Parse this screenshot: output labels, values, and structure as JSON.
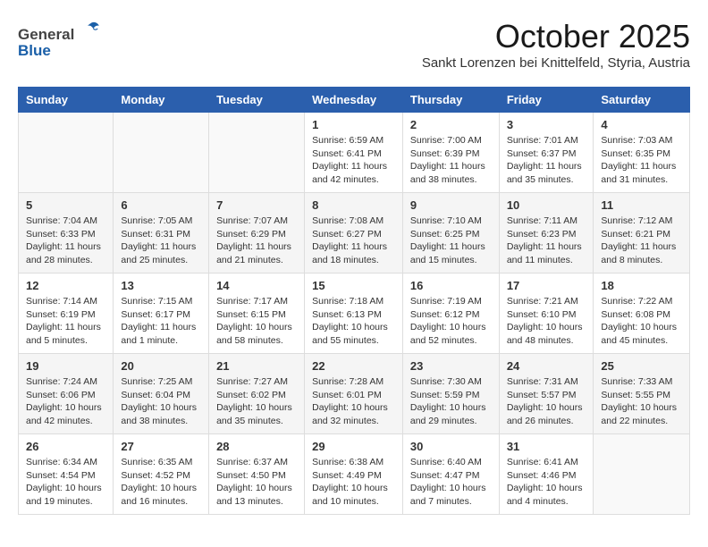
{
  "logo": {
    "general": "General",
    "blue": "Blue"
  },
  "header": {
    "month_title": "October 2025",
    "location": "Sankt Lorenzen bei Knittelfeld, Styria, Austria"
  },
  "weekdays": [
    "Sunday",
    "Monday",
    "Tuesday",
    "Wednesday",
    "Thursday",
    "Friday",
    "Saturday"
  ],
  "weeks": [
    [
      {
        "day": "",
        "sunrise": "",
        "sunset": "",
        "daylight": ""
      },
      {
        "day": "",
        "sunrise": "",
        "sunset": "",
        "daylight": ""
      },
      {
        "day": "",
        "sunrise": "",
        "sunset": "",
        "daylight": ""
      },
      {
        "day": "1",
        "sunrise": "Sunrise: 6:59 AM",
        "sunset": "Sunset: 6:41 PM",
        "daylight": "Daylight: 11 hours and 42 minutes."
      },
      {
        "day": "2",
        "sunrise": "Sunrise: 7:00 AM",
        "sunset": "Sunset: 6:39 PM",
        "daylight": "Daylight: 11 hours and 38 minutes."
      },
      {
        "day": "3",
        "sunrise": "Sunrise: 7:01 AM",
        "sunset": "Sunset: 6:37 PM",
        "daylight": "Daylight: 11 hours and 35 minutes."
      },
      {
        "day": "4",
        "sunrise": "Sunrise: 7:03 AM",
        "sunset": "Sunset: 6:35 PM",
        "daylight": "Daylight: 11 hours and 31 minutes."
      }
    ],
    [
      {
        "day": "5",
        "sunrise": "Sunrise: 7:04 AM",
        "sunset": "Sunset: 6:33 PM",
        "daylight": "Daylight: 11 hours and 28 minutes."
      },
      {
        "day": "6",
        "sunrise": "Sunrise: 7:05 AM",
        "sunset": "Sunset: 6:31 PM",
        "daylight": "Daylight: 11 hours and 25 minutes."
      },
      {
        "day": "7",
        "sunrise": "Sunrise: 7:07 AM",
        "sunset": "Sunset: 6:29 PM",
        "daylight": "Daylight: 11 hours and 21 minutes."
      },
      {
        "day": "8",
        "sunrise": "Sunrise: 7:08 AM",
        "sunset": "Sunset: 6:27 PM",
        "daylight": "Daylight: 11 hours and 18 minutes."
      },
      {
        "day": "9",
        "sunrise": "Sunrise: 7:10 AM",
        "sunset": "Sunset: 6:25 PM",
        "daylight": "Daylight: 11 hours and 15 minutes."
      },
      {
        "day": "10",
        "sunrise": "Sunrise: 7:11 AM",
        "sunset": "Sunset: 6:23 PM",
        "daylight": "Daylight: 11 hours and 11 minutes."
      },
      {
        "day": "11",
        "sunrise": "Sunrise: 7:12 AM",
        "sunset": "Sunset: 6:21 PM",
        "daylight": "Daylight: 11 hours and 8 minutes."
      }
    ],
    [
      {
        "day": "12",
        "sunrise": "Sunrise: 7:14 AM",
        "sunset": "Sunset: 6:19 PM",
        "daylight": "Daylight: 11 hours and 5 minutes."
      },
      {
        "day": "13",
        "sunrise": "Sunrise: 7:15 AM",
        "sunset": "Sunset: 6:17 PM",
        "daylight": "Daylight: 11 hours and 1 minute."
      },
      {
        "day": "14",
        "sunrise": "Sunrise: 7:17 AM",
        "sunset": "Sunset: 6:15 PM",
        "daylight": "Daylight: 10 hours and 58 minutes."
      },
      {
        "day": "15",
        "sunrise": "Sunrise: 7:18 AM",
        "sunset": "Sunset: 6:13 PM",
        "daylight": "Daylight: 10 hours and 55 minutes."
      },
      {
        "day": "16",
        "sunrise": "Sunrise: 7:19 AM",
        "sunset": "Sunset: 6:12 PM",
        "daylight": "Daylight: 10 hours and 52 minutes."
      },
      {
        "day": "17",
        "sunrise": "Sunrise: 7:21 AM",
        "sunset": "Sunset: 6:10 PM",
        "daylight": "Daylight: 10 hours and 48 minutes."
      },
      {
        "day": "18",
        "sunrise": "Sunrise: 7:22 AM",
        "sunset": "Sunset: 6:08 PM",
        "daylight": "Daylight: 10 hours and 45 minutes."
      }
    ],
    [
      {
        "day": "19",
        "sunrise": "Sunrise: 7:24 AM",
        "sunset": "Sunset: 6:06 PM",
        "daylight": "Daylight: 10 hours and 42 minutes."
      },
      {
        "day": "20",
        "sunrise": "Sunrise: 7:25 AM",
        "sunset": "Sunset: 6:04 PM",
        "daylight": "Daylight: 10 hours and 38 minutes."
      },
      {
        "day": "21",
        "sunrise": "Sunrise: 7:27 AM",
        "sunset": "Sunset: 6:02 PM",
        "daylight": "Daylight: 10 hours and 35 minutes."
      },
      {
        "day": "22",
        "sunrise": "Sunrise: 7:28 AM",
        "sunset": "Sunset: 6:01 PM",
        "daylight": "Daylight: 10 hours and 32 minutes."
      },
      {
        "day": "23",
        "sunrise": "Sunrise: 7:30 AM",
        "sunset": "Sunset: 5:59 PM",
        "daylight": "Daylight: 10 hours and 29 minutes."
      },
      {
        "day": "24",
        "sunrise": "Sunrise: 7:31 AM",
        "sunset": "Sunset: 5:57 PM",
        "daylight": "Daylight: 10 hours and 26 minutes."
      },
      {
        "day": "25",
        "sunrise": "Sunrise: 7:33 AM",
        "sunset": "Sunset: 5:55 PM",
        "daylight": "Daylight: 10 hours and 22 minutes."
      }
    ],
    [
      {
        "day": "26",
        "sunrise": "Sunrise: 6:34 AM",
        "sunset": "Sunset: 4:54 PM",
        "daylight": "Daylight: 10 hours and 19 minutes."
      },
      {
        "day": "27",
        "sunrise": "Sunrise: 6:35 AM",
        "sunset": "Sunset: 4:52 PM",
        "daylight": "Daylight: 10 hours and 16 minutes."
      },
      {
        "day": "28",
        "sunrise": "Sunrise: 6:37 AM",
        "sunset": "Sunset: 4:50 PM",
        "daylight": "Daylight: 10 hours and 13 minutes."
      },
      {
        "day": "29",
        "sunrise": "Sunrise: 6:38 AM",
        "sunset": "Sunset: 4:49 PM",
        "daylight": "Daylight: 10 hours and 10 minutes."
      },
      {
        "day": "30",
        "sunrise": "Sunrise: 6:40 AM",
        "sunset": "Sunset: 4:47 PM",
        "daylight": "Daylight: 10 hours and 7 minutes."
      },
      {
        "day": "31",
        "sunrise": "Sunrise: 6:41 AM",
        "sunset": "Sunset: 4:46 PM",
        "daylight": "Daylight: 10 hours and 4 minutes."
      },
      {
        "day": "",
        "sunrise": "",
        "sunset": "",
        "daylight": ""
      }
    ]
  ]
}
